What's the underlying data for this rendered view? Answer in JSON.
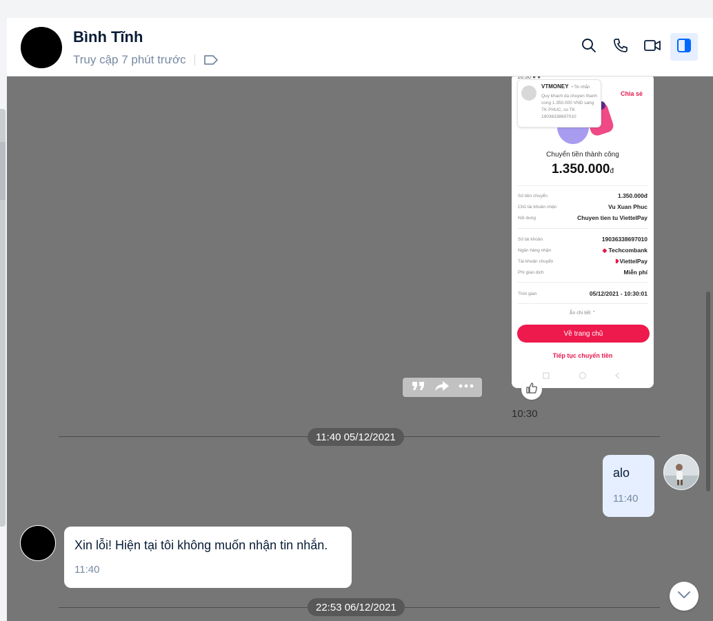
{
  "header": {
    "contact_name": "Bình Tĩnh",
    "last_seen": "Truy cập 7 phút trước",
    "icons": [
      "search-icon",
      "phone-icon",
      "video-call-icon",
      "sidebar-toggle-icon",
      "label-tag-icon"
    ]
  },
  "image_message": {
    "notification": {
      "title": "VTMONEY",
      "tag": "• Tin nhắn",
      "text": "Quy khach da chuyen thanh cong 1.350.000 VND sang TK PHUC, so TK 19036338697010"
    },
    "share_label": "Chia sẻ",
    "success_title": "Chuyển tiền thành công",
    "amount": "1.350.000",
    "currency": "đ",
    "rows1": [
      {
        "key": "Số tiền chuyển",
        "value": "1.350.000đ"
      },
      {
        "key": "Chủ tài khoản nhận",
        "value": "Vu Xuan Phuc"
      },
      {
        "key": "Nội dung",
        "value": "Chuyen tien tu ViettelPay"
      }
    ],
    "rows2": [
      {
        "key": "Số tài khoản",
        "value": "19036338697010"
      },
      {
        "key": "Ngân hàng nhận",
        "value": "Techcombank"
      },
      {
        "key": "Tài khoản chuyển",
        "value": "ViettelPay"
      },
      {
        "key": "Phí giao dịch",
        "value": "Miễn phí"
      }
    ],
    "time_row": {
      "key": "Thời gian",
      "value": "05/12/2021 - 10:30:01"
    },
    "hide_details": "Ẩn chi tiết",
    "home_button": "Về trang chủ",
    "continue_link": "Tiếp tục chuyển tiền",
    "sent_time": "10:30"
  },
  "messages": {
    "date1": "11:40 05/12/2021",
    "me_text": "alo",
    "me_time": "11:40",
    "them_text": "Xin lỗi! Hiện tại tôi không muốn nhận tin nhắn.",
    "them_time": "11:40",
    "date2": "22:53 06/12/2021"
  },
  "colors": {
    "chat_background": "#767676",
    "my_bubble": "#e5efff",
    "their_bubble": "#ffffff",
    "accent": "#0068ff",
    "viettel_red": "#ee1a4d"
  }
}
